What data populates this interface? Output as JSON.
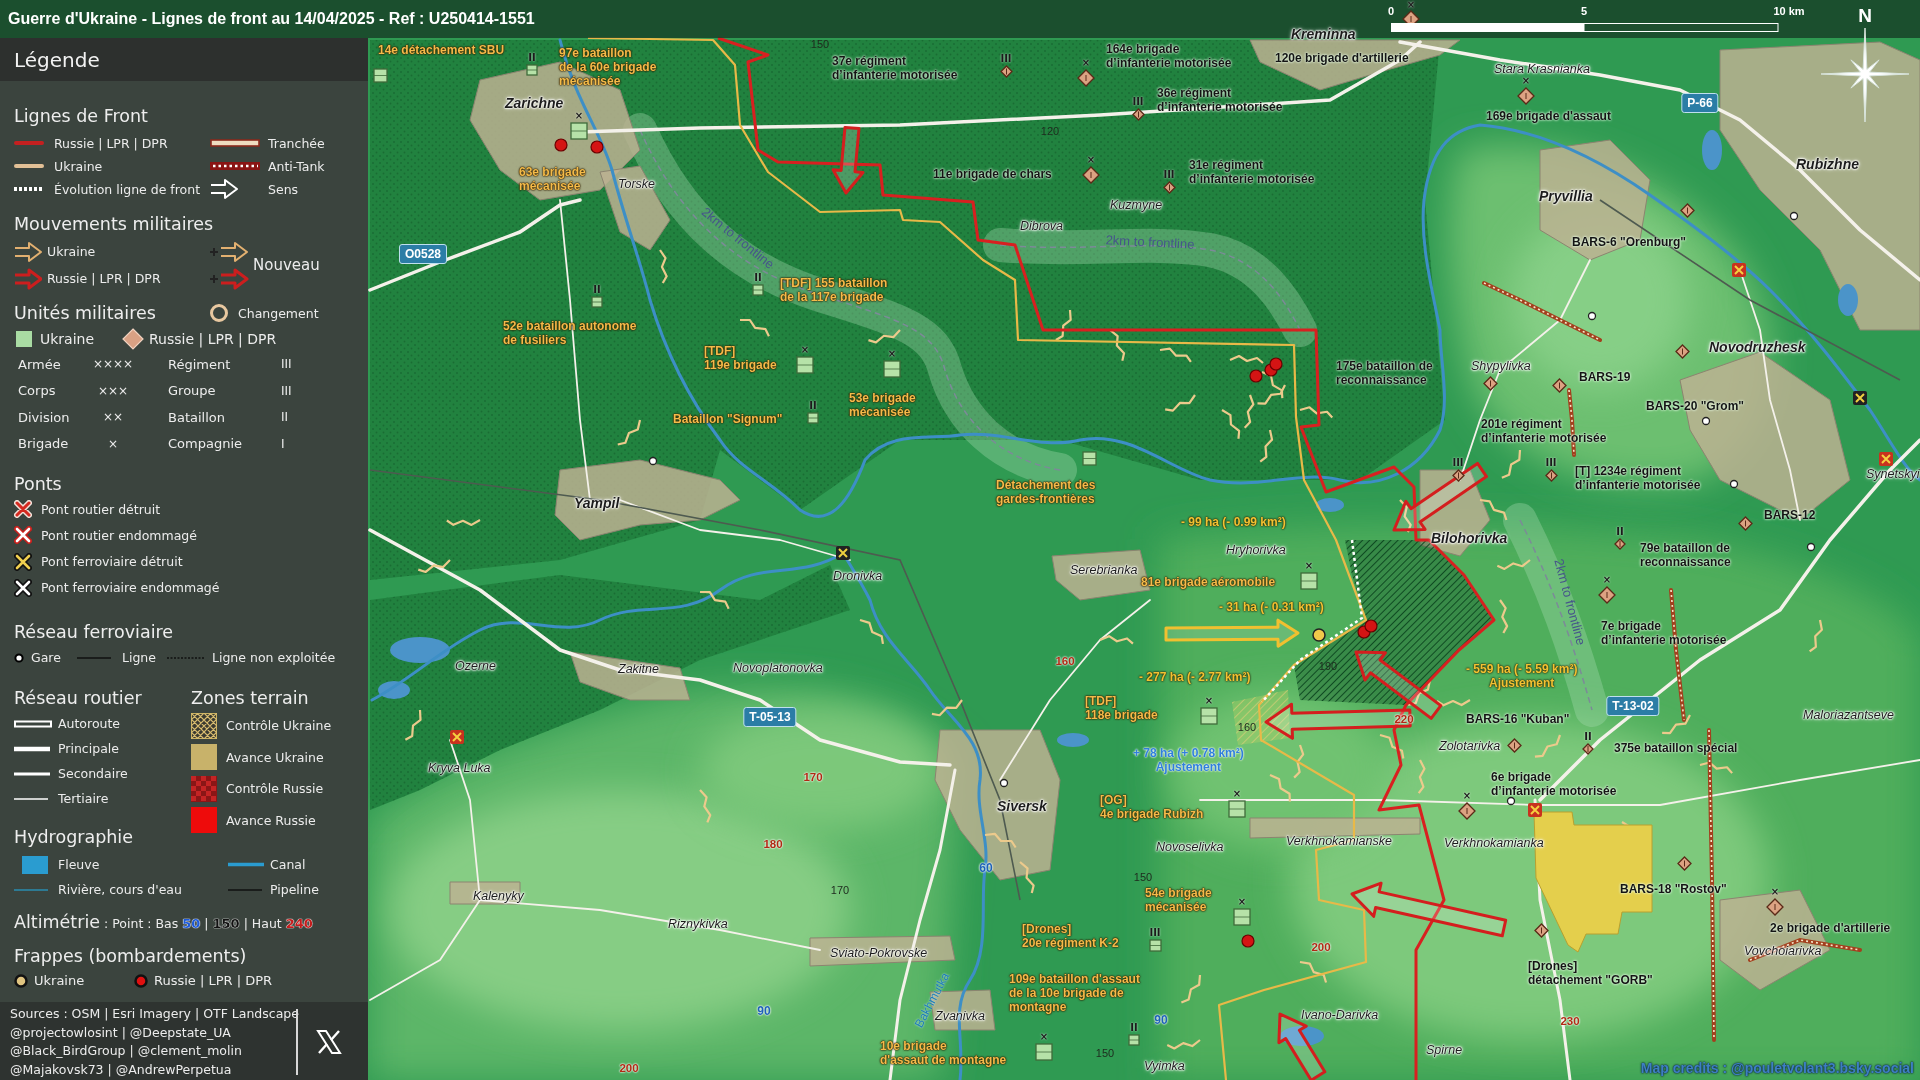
{
  "title_bar": {
    "title": "Guerre d'Ukraine - Lignes de front au 14/04/2025 - Ref : U250414-1551"
  },
  "scale_bar": {
    "ticks": [
      "0",
      "5",
      "10 km"
    ]
  },
  "compass": {
    "label": "N"
  },
  "legend": {
    "title": "Légende",
    "front_lines": {
      "heading": "Lignes de Front",
      "items": [
        {
          "kind": "russia-line",
          "label": "Russie | LPR | DPR"
        },
        {
          "kind": "trench",
          "label": "Tranchée"
        },
        {
          "kind": "ukraine-line",
          "label": "Ukraine"
        },
        {
          "kind": "anti-tank",
          "label": "Anti-Tank"
        },
        {
          "kind": "evolution",
          "label": "Évolution ligne de front"
        },
        {
          "kind": "direction",
          "label": "Sens"
        }
      ]
    },
    "movements": {
      "heading": "Mouvements militaires",
      "items": [
        {
          "kind": "ukraine",
          "label": "Ukraine"
        },
        {
          "kind": "russia",
          "label": "Russie | LPR | DPR"
        }
      ],
      "new_label": "Nouveau"
    },
    "units": {
      "heading": "Unités militaires",
      "change_label": "Changement",
      "sides": [
        {
          "kind": "ukraine",
          "label": "Ukraine"
        },
        {
          "kind": "russia",
          "label": "Russie | LPR | DPR"
        }
      ],
      "echelons": [
        {
          "name": "Armée",
          "symbol": "××××"
        },
        {
          "name": "Régiment",
          "symbol": "III"
        },
        {
          "name": "Corps",
          "symbol": "×××"
        },
        {
          "name": "Groupe",
          "symbol": "III"
        },
        {
          "name": "Division",
          "symbol": "××"
        },
        {
          "name": "Bataillon",
          "symbol": "II"
        },
        {
          "name": "Brigade",
          "symbol": "×"
        },
        {
          "name": "Compagnie",
          "symbol": "I"
        }
      ]
    },
    "bridges": {
      "heading": "Ponts",
      "items": [
        {
          "kind": "road-destroyed",
          "label": "Pont routier détruit"
        },
        {
          "kind": "road-damaged",
          "label": "Pont routier endommagé"
        },
        {
          "kind": "rail-destroyed",
          "label": "Pont ferroviaire détruit"
        },
        {
          "kind": "rail-damaged",
          "label": "Pont ferroviaire endommagé"
        }
      ]
    },
    "railway": {
      "heading": "Réseau ferroviaire",
      "items": [
        {
          "kind": "station",
          "label": "Gare"
        },
        {
          "kind": "line",
          "label": "Ligne"
        },
        {
          "kind": "disused",
          "label": "Ligne non exploitée"
        }
      ]
    },
    "roads": {
      "heading": "Réseau routier",
      "items": [
        {
          "kind": "motorway",
          "label": "Autoroute"
        },
        {
          "kind": "primary",
          "label": "Principale"
        },
        {
          "kind": "secondary",
          "label": "Secondaire"
        },
        {
          "kind": "tertiary",
          "label": "Tertiaire"
        }
      ]
    },
    "terrain": {
      "heading": "Zones terrain",
      "items": [
        {
          "kind": "ukraine-control",
          "label": "Contrôle Ukraine"
        },
        {
          "kind": "ukraine-advance",
          "label": "Avance Ukraine"
        },
        {
          "kind": "russia-control",
          "label": "Contrôle Russie"
        },
        {
          "kind": "russia-advance",
          "label": "Avance Russie"
        }
      ]
    },
    "hydrography": {
      "heading": "Hydrographie",
      "items": [
        {
          "kind": "river",
          "label": "Fleuve"
        },
        {
          "kind": "canal",
          "label": "Canal"
        },
        {
          "kind": "stream",
          "label": "Rivière, cours d'eau"
        },
        {
          "kind": "pipeline",
          "label": "Pipeline"
        }
      ]
    },
    "altimetry": {
      "heading": "Altimétrie",
      "parts": [
        {
          "kind": "text",
          "text": ": Point : Bas"
        },
        {
          "kind": "low",
          "text": "50"
        },
        {
          "kind": "text",
          "text": "|"
        },
        {
          "kind": "mid",
          "text": "150"
        },
        {
          "kind": "text",
          "text": "| Haut"
        },
        {
          "kind": "high",
          "text": "240"
        }
      ]
    },
    "strikes": {
      "heading": "Frappes (bombardements)",
      "items": [
        {
          "kind": "ukraine",
          "label": "Ukraine"
        },
        {
          "kind": "russia",
          "label": "Russie | LPR | DPR"
        }
      ]
    },
    "sources": {
      "lines": [
        "Sources : OSM | Esri Imagery | OTF Landscape",
        "@projectowlosint | @Deepstate_UA",
        "@Black_BirdGroup | @clement_molin",
        "@Majakovsk73 | @AndrewPerpetua"
      ]
    }
  },
  "map": {
    "places": [
      {
        "name": "Kreminna",
        "kind": "town"
      },
      {
        "name": "Stara Krasnianka",
        "kind": "village"
      },
      {
        "name": "Zarichne",
        "kind": "town"
      },
      {
        "name": "Rubizhne",
        "kind": "town"
      },
      {
        "name": "Torske",
        "kind": "village"
      },
      {
        "name": "Kuzmyne",
        "kind": "village"
      },
      {
        "name": "Pryvillia",
        "kind": "town"
      },
      {
        "name": "Dibrova",
        "kind": "village"
      },
      {
        "name": "Novodruzhesk",
        "kind": "town"
      },
      {
        "name": "Shypylivka",
        "kind": "village"
      },
      {
        "name": "Synetskyi",
        "kind": "village"
      },
      {
        "name": "Yampil",
        "kind": "town"
      },
      {
        "name": "Hryhorivka",
        "kind": "village"
      },
      {
        "name": "Bilohorivka",
        "kind": "town"
      },
      {
        "name": "Dronivka",
        "kind": "village"
      },
      {
        "name": "Serebrianka",
        "kind": "village"
      },
      {
        "name": "Ozerne",
        "kind": "village"
      },
      {
        "name": "Zakitne",
        "kind": "village"
      },
      {
        "name": "Novoplatonovka",
        "kind": "village"
      },
      {
        "name": "Maloriazantseve",
        "kind": "village"
      },
      {
        "name": "Zolotarivka",
        "kind": "village"
      },
      {
        "name": "Kryva Luka",
        "kind": "village"
      },
      {
        "name": "Siversk",
        "kind": "town"
      },
      {
        "name": "Novoselivka",
        "kind": "village"
      },
      {
        "name": "Verkhnokamianske",
        "kind": "village"
      },
      {
        "name": "Verkhnokamianka",
        "kind": "village"
      },
      {
        "name": "Kalenyky",
        "kind": "village"
      },
      {
        "name": "Riznykivka",
        "kind": "village"
      },
      {
        "name": "Sviato-Pokrovske",
        "kind": "village"
      },
      {
        "name": "Vovchoiarivka",
        "kind": "village"
      },
      {
        "name": "Zvanivka",
        "kind": "village"
      },
      {
        "name": "Ivano-Darivka",
        "kind": "village"
      },
      {
        "name": "Spirne",
        "kind": "village"
      },
      {
        "name": "Vyimka",
        "kind": "village"
      }
    ],
    "units": [
      {
        "kind": "ukraine",
        "lines": [
          "14e détachement SBU"
        ]
      },
      {
        "kind": "ukraine",
        "lines": [
          "97e bataillon",
          "de la 60e brigade",
          "mécanisée"
        ],
        "echelon": "II"
      },
      {
        "kind": "russia",
        "lines": [
          "37e régiment",
          "d’infanterie motorisée"
        ],
        "echelon": "III"
      },
      {
        "kind": "russia",
        "lines": [
          "164e brigade",
          "d’infanterie motorisée"
        ],
        "echelon": "×"
      },
      {
        "kind": "russia",
        "lines": [
          "120e brigade d'artillerie"
        ],
        "echelon": "×"
      },
      {
        "kind": "russia",
        "lines": [
          "36e régiment",
          "d’infanterie motorisée"
        ],
        "echelon": "III"
      },
      {
        "kind": "russia",
        "lines": [
          "169e brigade d'assaut"
        ],
        "echelon": "×"
      },
      {
        "kind": "ukraine",
        "lines": [
          "63e brigade",
          "mécanisée"
        ],
        "echelon": "×"
      },
      {
        "kind": "russia",
        "lines": [
          "11e brigade de chars"
        ],
        "echelon": "×"
      },
      {
        "kind": "russia",
        "lines": [
          "31e régiment",
          "d’infanterie motorisée"
        ],
        "echelon": "III"
      },
      {
        "kind": "russia",
        "lines": [
          "BARS-6 \"Orenburg\""
        ]
      },
      {
        "kind": "ukraine",
        "lines": [
          "[TDF] 155 bataillon",
          "de la 117e brigade"
        ],
        "echelon": "II"
      },
      {
        "kind": "ukraine",
        "lines": [
          "52e bataillon autonome",
          "de fusiliers"
        ],
        "echelon": "II"
      },
      {
        "kind": "ukraine",
        "lines": [
          "[TDF]",
          "119e brigade"
        ],
        "echelon": "×"
      },
      {
        "kind": "russia",
        "lines": [
          "175e bataillon de",
          "reconnaissance"
        ]
      },
      {
        "kind": "russia",
        "lines": [
          "BARS-19"
        ]
      },
      {
        "kind": "ukraine",
        "lines": [
          "Bataillon \"Signum\""
        ],
        "echelon": "II"
      },
      {
        "kind": "ukraine",
        "lines": [
          "53e brigade",
          "mécanisée"
        ],
        "echelon": "×"
      },
      {
        "kind": "russia",
        "lines": [
          "201e régiment",
          "d’infanterie motorisée"
        ],
        "echelon": "III"
      },
      {
        "kind": "russia",
        "lines": [
          "BARS-20 \"Grom\""
        ]
      },
      {
        "kind": "ukraine",
        "lines": [
          "Détachement des",
          "gardes-frontières"
        ]
      },
      {
        "kind": "russia",
        "lines": [
          "[T] 1234e régiment",
          "d’infanterie motorisée"
        ],
        "echelon": "III"
      },
      {
        "kind": "russia",
        "lines": [
          "BARS-12"
        ]
      },
      {
        "kind": "russia",
        "lines": [
          "79e bataillon de",
          "reconnaissance"
        ],
        "echelon": "II"
      },
      {
        "kind": "ukraine",
        "lines": [
          "81e brigade aéromobile"
        ],
        "echelon": "×"
      },
      {
        "kind": "russia",
        "lines": [
          "7e brigade",
          "d’infanterie motorisée"
        ],
        "echelon": "×"
      },
      {
        "kind": "ukraine",
        "lines": [
          "[TDF]",
          "118e brigade"
        ],
        "echelon": "×"
      },
      {
        "kind": "russia",
        "lines": [
          "BARS-16 \"Kuban\""
        ]
      },
      {
        "kind": "russia",
        "lines": [
          "375e bataillon spécial"
        ],
        "echelon": "II"
      },
      {
        "kind": "ukraine",
        "lines": [
          "[OG]",
          "4e brigade Rubizh"
        ],
        "echelon": "×"
      },
      {
        "kind": "russia",
        "lines": [
          "6e brigade",
          "d’infanterie motorisée"
        ],
        "echelon": "×"
      },
      {
        "kind": "ukraine",
        "lines": [
          "54e brigade",
          "mécanisée"
        ],
        "echelon": "×"
      },
      {
        "kind": "russia",
        "lines": [
          "BARS-18 \"Rostov\""
        ]
      },
      {
        "kind": "ukraine",
        "lines": [
          "[Drones]",
          "20e régiment K-2"
        ],
        "echelon": "III"
      },
      {
        "kind": "russia",
        "lines": [
          "2e brigade d'artillerie"
        ],
        "echelon": "×"
      },
      {
        "kind": "ukraine",
        "lines": [
          "109e bataillon d'assaut",
          "de la 10e brigade de",
          "montagne"
        ],
        "echelon": "II"
      },
      {
        "kind": "russia",
        "lines": [
          "[Drones]",
          "détachement \"GORB\""
        ]
      },
      {
        "kind": "ukraine",
        "lines": [
          "10e brigade",
          "d'assaut de montagne"
        ],
        "echelon": "×"
      }
    ],
    "area_changes": [
      {
        "kind": "loss",
        "lines": [
          "- 99 ha (- 0.99 km²)"
        ]
      },
      {
        "kind": "loss",
        "lines": [
          "- 31 ha (- 0.31 km²)"
        ]
      },
      {
        "kind": "loss",
        "lines": [
          "- 277 ha (- 2.77 km²)"
        ]
      },
      {
        "kind": "loss",
        "lines": [
          "- 559 ha (- 5.59 km²)",
          "Ajustement"
        ]
      },
      {
        "kind": "gain",
        "lines": [
          "+ 78 ha (+ 0.78 km²)",
          "Ajustement"
        ]
      }
    ],
    "elevations": [
      {
        "kind": "contour",
        "value": "150"
      },
      {
        "kind": "contour",
        "value": "120"
      },
      {
        "kind": "high",
        "value": "160"
      },
      {
        "kind": "contour",
        "value": "190"
      },
      {
        "kind": "contour",
        "value": "160"
      },
      {
        "kind": "high",
        "value": "220"
      },
      {
        "kind": "high",
        "value": "170"
      },
      {
        "kind": "high",
        "value": "180"
      },
      {
        "kind": "low",
        "value": "60"
      },
      {
        "kind": "contour",
        "value": "150"
      },
      {
        "kind": "contour",
        "value": "170"
      },
      {
        "kind": "high",
        "value": "200"
      },
      {
        "kind": "low",
        "value": "90"
      },
      {
        "kind": "low",
        "value": "90"
      },
      {
        "kind": "high",
        "value": "230"
      },
      {
        "kind": "contour",
        "value": "150"
      },
      {
        "kind": "high",
        "value": "200"
      }
    ],
    "road_numbers": [
      "P-66",
      "O0528",
      "T-05-13",
      "T-13-02"
    ],
    "distance_labels": [
      "2km to frontline",
      "2km to frontline",
      "2km to frontline"
    ],
    "river_labels": [
      "Bakhmutka"
    ]
  },
  "credits": "Map credits : @pouletvolant3.bsky.social"
}
